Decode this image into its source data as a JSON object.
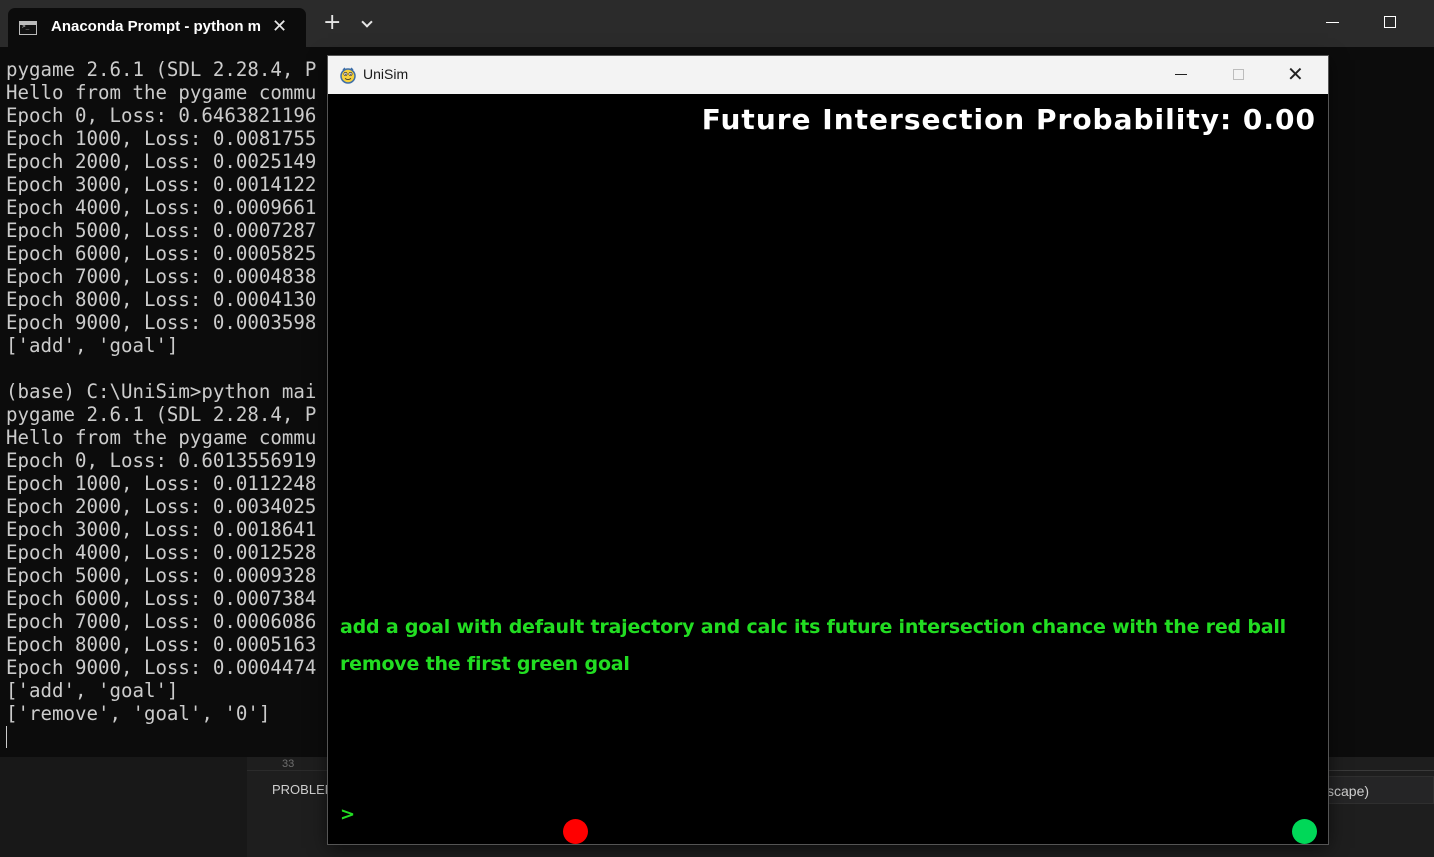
{
  "ide_background": {
    "problems_tab": "PROBLEM",
    "line_number": "33",
    "right_field_text": "scape)"
  },
  "terminal": {
    "tab_title": "Anaconda Prompt - python  m",
    "tab_icon": "terminal-icon",
    "close_tab_glyph": "✕",
    "new_tab_glyph": "+",
    "lines": [
      "pygame 2.6.1 (SDL 2.28.4, P",
      "Hello from the pygame commu",
      "Epoch 0, Loss: 0.6463821196",
      "Epoch 1000, Loss: 0.0081755",
      "Epoch 2000, Loss: 0.0025149",
      "Epoch 3000, Loss: 0.0014122",
      "Epoch 4000, Loss: 0.0009661",
      "Epoch 5000, Loss: 0.0007287",
      "Epoch 6000, Loss: 0.0005825",
      "Epoch 7000, Loss: 0.0004838",
      "Epoch 8000, Loss: 0.0004130",
      "Epoch 9000, Loss: 0.0003598",
      "['add', 'goal']",
      "",
      "(base) C:\\UniSim>python mai",
      "pygame 2.6.1 (SDL 2.28.4, P",
      "Hello from the pygame commu",
      "Epoch 0, Loss: 0.6013556919",
      "Epoch 1000, Loss: 0.0112248",
      "Epoch 2000, Loss: 0.0034025",
      "Epoch 3000, Loss: 0.0018641",
      "Epoch 4000, Loss: 0.0012528",
      "Epoch 5000, Loss: 0.0009328",
      "Epoch 6000, Loss: 0.0007384",
      "Epoch 7000, Loss: 0.0006086",
      "Epoch 8000, Loss: 0.0005163",
      "Epoch 9000, Loss: 0.0004474",
      "['add', 'goal']",
      "['remove', 'goal', '0']"
    ]
  },
  "unisim": {
    "window_title": "UniSim",
    "app_icon": "pygame-snake-icon",
    "close_glyph": "✕",
    "probability_text": "Future Intersection Probability: 0.00",
    "command_history": [
      "add a goal with default trajectory and calc its future intersection chance with the red ball",
      "remove the first green goal"
    ],
    "input_prompt": ">",
    "red_ball_color": "#ff0000",
    "green_goal_color": "#00d858"
  }
}
